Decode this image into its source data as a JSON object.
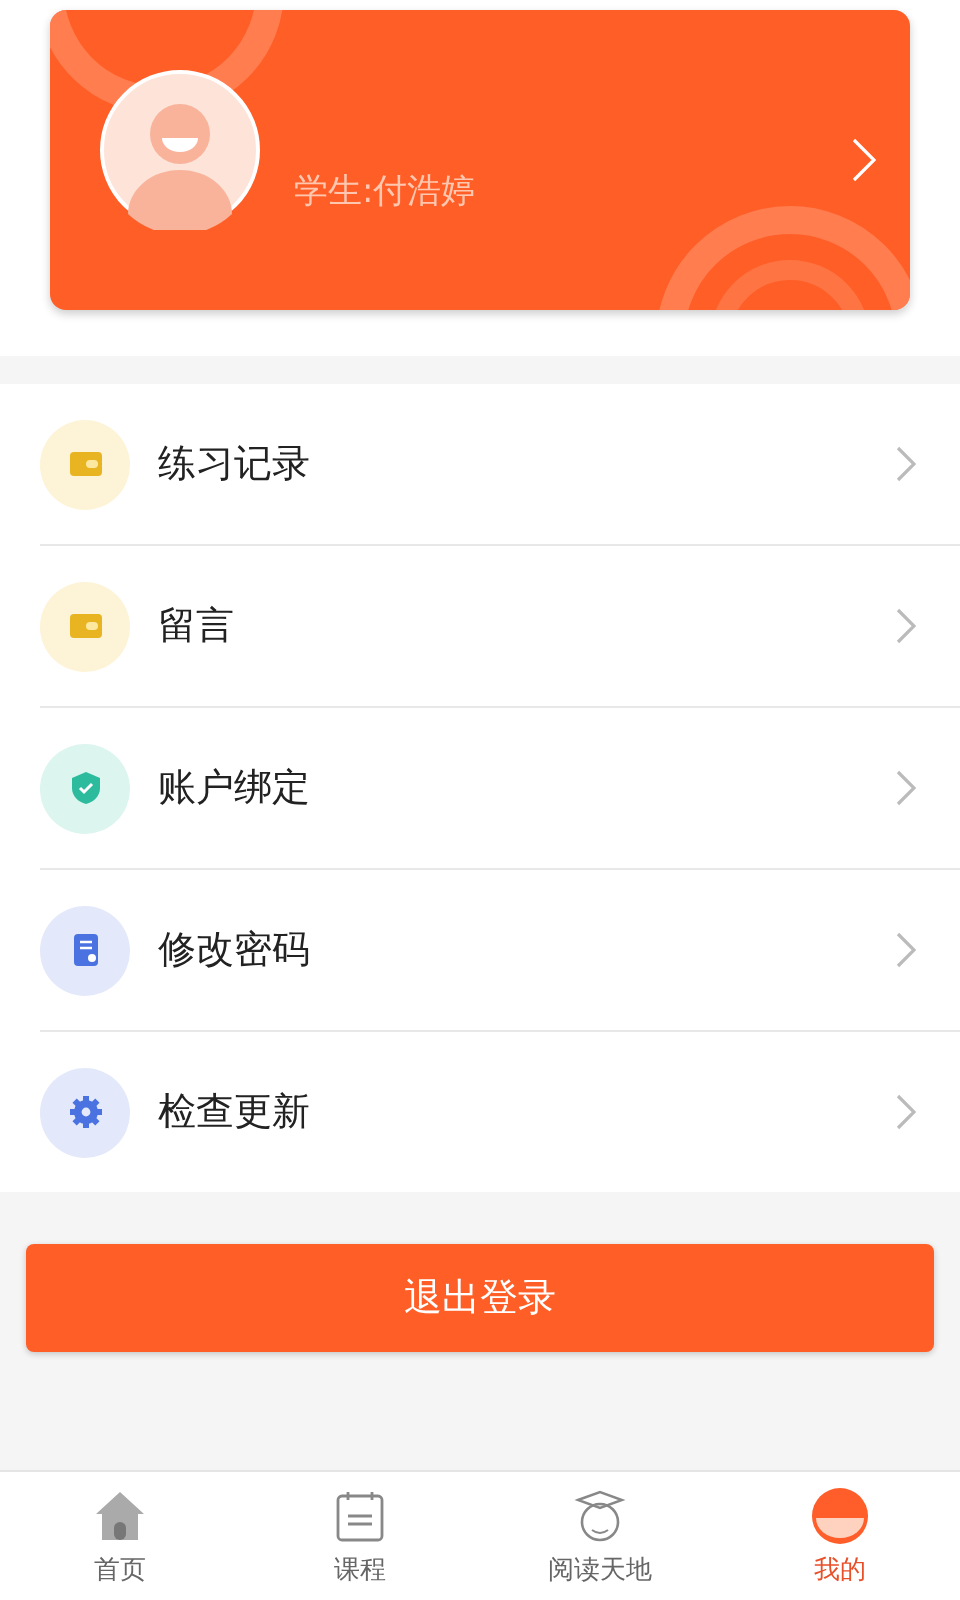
{
  "profile": {
    "name": "学生:付浩婷"
  },
  "menu": [
    {
      "kind": "wallet",
      "label": "练习记录"
    },
    {
      "kind": "wallet",
      "label": "留言"
    },
    {
      "kind": "shield",
      "label": "账户绑定"
    },
    {
      "kind": "document",
      "label": "修改密码"
    },
    {
      "kind": "gear",
      "label": "检查更新"
    }
  ],
  "logout_button": "退出登录",
  "tabs": [
    {
      "kind": "home",
      "label": "首页",
      "selected": false
    },
    {
      "kind": "calendar",
      "label": "课程",
      "selected": false
    },
    {
      "kind": "student",
      "label": "阅读天地",
      "selected": false
    },
    {
      "kind": "me",
      "label": "我的",
      "selected": true
    }
  ]
}
